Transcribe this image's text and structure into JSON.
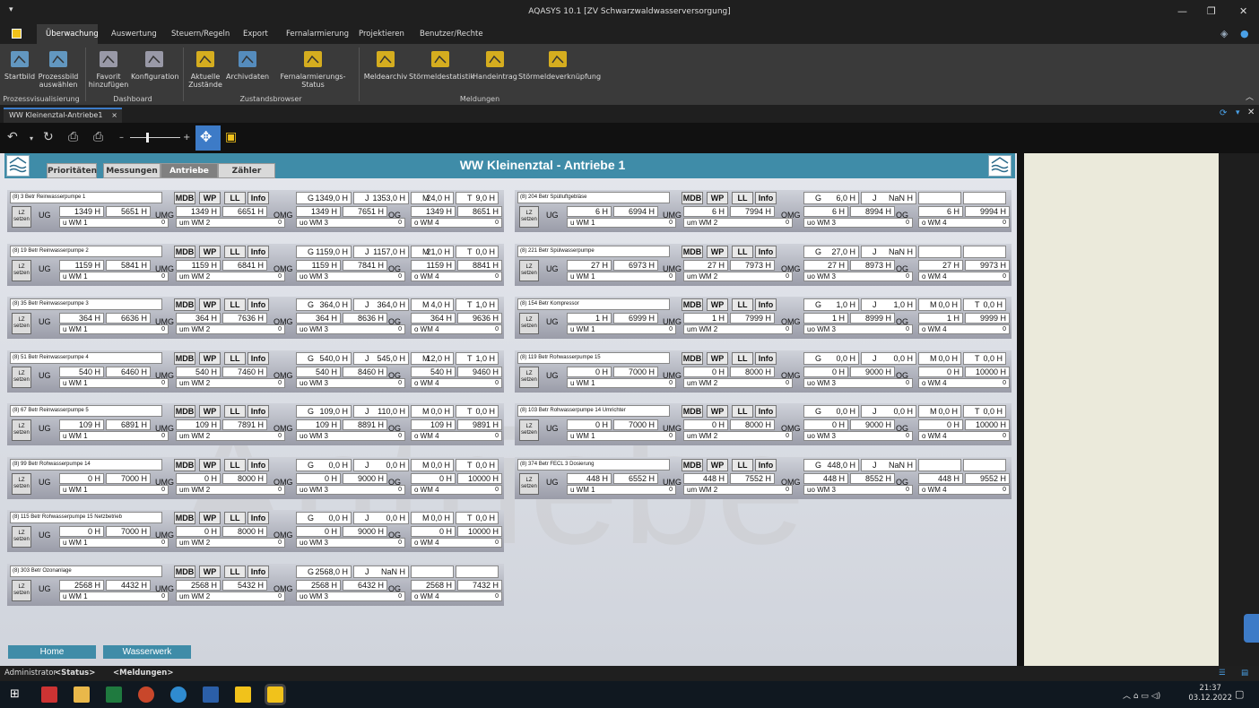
{
  "window": {
    "title": "AQASYS 10.1 [ZV Schwarzwaldwasserversorgung]",
    "qa_arrow": "▾"
  },
  "menu": [
    "Überwachung",
    "Auswertung",
    "Steuern/Regeln",
    "Export",
    "Fernalarmierung",
    "Projektieren",
    "Benutzer/Rechte"
  ],
  "ribbon": {
    "buttons": [
      {
        "label": "Startbild",
        "icon": "image-icon"
      },
      {
        "label": "Prozessbild auswählen",
        "icon": "picture-select-icon"
      },
      {
        "label": "Favorit hinzufügen",
        "icon": "favorite-eye-icon"
      },
      {
        "label": "Konfiguration",
        "icon": "config-gear-icon"
      },
      {
        "label": "Aktuelle Zustände",
        "icon": "current-states-icon"
      },
      {
        "label": "Archivdaten",
        "icon": "database-icon"
      },
      {
        "label": "Fernalarmierungs-Status",
        "icon": "alarm-status-icon"
      },
      {
        "label": "Meldearchiv",
        "icon": "message-archive-icon"
      },
      {
        "label": "Störmeldestatistik",
        "icon": "fault-statistics-icon"
      },
      {
        "label": "Handeintrag",
        "icon": "manual-entry-icon"
      },
      {
        "label": "Störmeldeverknüpfung",
        "icon": "fault-link-icon"
      }
    ],
    "groups": [
      "Prozessvisualisierung",
      "Dashboard",
      "Zustandsbrowser",
      "Meldungen"
    ]
  },
  "doctab": {
    "label": "WW Kleinenztal-Antriebe1",
    "close": "×"
  },
  "page": {
    "title": "WW Kleinenztal - Antriebe 1",
    "tabs": [
      "Prioritäten",
      "Messungen",
      "Antriebe",
      "Zähler"
    ],
    "active_tab": "Antriebe",
    "watermark": "Antriebe"
  },
  "labels": {
    "ug": "UG",
    "umg": "UMG",
    "omg": "OMG",
    "og": "OG",
    "lz": "LZ",
    "setzen": "setzen",
    "mdb": "MDB",
    "wp": "WP",
    "ll": "LL",
    "info": "Info",
    "uwm": "u WM 1",
    "umwm": "um WM 2",
    "uowm": "uo WM 3",
    "owm": "o WM 4"
  },
  "units": [
    {
      "pri": "(8)",
      "id": "3",
      "name": "Betr Reinwasserpumpe 1",
      "h": [
        [
          "G",
          "1349,0 H"
        ],
        [
          "J",
          "1353,0 H"
        ],
        [
          "M",
          "24,0 H"
        ],
        [
          "T",
          "9,0 H"
        ]
      ],
      "v": [
        "1349 H",
        "5651 H",
        "1349 H",
        "6651 H",
        "1349 H",
        "7651 H",
        "1349 H",
        "8651 H"
      ]
    },
    {
      "pri": "(8)",
      "id": "19",
      "name": "Betr Reinwasserpumpe 2",
      "h": [
        [
          "G",
          "1159,0 H"
        ],
        [
          "J",
          "1157,0 H"
        ],
        [
          "M",
          "21,0 H"
        ],
        [
          "T",
          "0,0 H"
        ]
      ],
      "v": [
        "1159 H",
        "5841 H",
        "1159 H",
        "6841 H",
        "1159 H",
        "7841 H",
        "1159 H",
        "8841 H"
      ]
    },
    {
      "pri": "(8)",
      "id": "35",
      "name": "Betr Reinwasserpumpe 3",
      "h": [
        [
          "G",
          "364,0 H"
        ],
        [
          "J",
          "364,0 H"
        ],
        [
          "M",
          "4,0 H"
        ],
        [
          "T",
          "1,0 H"
        ]
      ],
      "v": [
        "364 H",
        "6636 H",
        "364 H",
        "7636 H",
        "364 H",
        "8636 H",
        "364 H",
        "9636 H"
      ]
    },
    {
      "pri": "(8)",
      "id": "51",
      "name": "Betr Reinwasserpumpe 4",
      "h": [
        [
          "G",
          "540,0 H"
        ],
        [
          "J",
          "545,0 H"
        ],
        [
          "M",
          "12,0 H"
        ],
        [
          "T",
          "1,0 H"
        ]
      ],
      "v": [
        "540 H",
        "6460 H",
        "540 H",
        "7460 H",
        "540 H",
        "8460 H",
        "540 H",
        "9460 H"
      ]
    },
    {
      "pri": "(8)",
      "id": "67",
      "name": "Betr Reinwasserpumpe 5",
      "h": [
        [
          "G",
          "109,0 H"
        ],
        [
          "J",
          "110,0 H"
        ],
        [
          "M",
          "0,0 H"
        ],
        [
          "T",
          "0,0 H"
        ]
      ],
      "v": [
        "109 H",
        "6891 H",
        "109 H",
        "7891 H",
        "109 H",
        "8891 H",
        "109 H",
        "9891 H"
      ]
    },
    {
      "pri": "(8)",
      "id": "99",
      "name": "Betr Rohwasserpumpe 14",
      "h": [
        [
          "G",
          "0,0 H"
        ],
        [
          "J",
          "0,0 H"
        ],
        [
          "M",
          "0,0 H"
        ],
        [
          "T",
          "0,0 H"
        ]
      ],
      "v": [
        "0 H",
        "7000 H",
        "0 H",
        "8000 H",
        "0 H",
        "9000 H",
        "0 H",
        "10000 H"
      ]
    },
    {
      "pri": "(8)",
      "id": "115",
      "name": "Betr Rohwasserpumpe 15 Netzbetrieb",
      "h": [
        [
          "G",
          "0,0 H"
        ],
        [
          "J",
          "0,0 H"
        ],
        [
          "M",
          "0,0 H"
        ],
        [
          "T",
          "0,0 H"
        ]
      ],
      "v": [
        "0 H",
        "7000 H",
        "0 H",
        "8000 H",
        "0 H",
        "9000 H",
        "0 H",
        "10000 H"
      ]
    },
    {
      "pri": "(8)",
      "id": "303",
      "name": "Betr Ozonanlage",
      "h": [
        [
          "G",
          "2568,0 H"
        ],
        [
          "J",
          "NaN H"
        ],
        [
          "",
          ""
        ],
        [
          "",
          ""
        ]
      ],
      "v": [
        "2568 H",
        "4432 H",
        "2568 H",
        "5432 H",
        "2568 H",
        "6432 H",
        "2568 H",
        "7432 H"
      ]
    },
    {
      "pri": "(8)",
      "id": "204",
      "name": "Betr Spülluftgebläse",
      "h": [
        [
          "G",
          "6,0 H"
        ],
        [
          "J",
          "NaN H"
        ],
        [
          "",
          ""
        ],
        [
          "",
          ""
        ]
      ],
      "v": [
        "6 H",
        "6994 H",
        "6 H",
        "7994 H",
        "6 H",
        "8994 H",
        "6 H",
        "9994 H"
      ]
    },
    {
      "pri": "(8)",
      "id": "221",
      "name": "Betr Spülwasserpumpe",
      "h": [
        [
          "G",
          "27,0 H"
        ],
        [
          "J",
          "NaN H"
        ],
        [
          "",
          ""
        ],
        [
          "",
          ""
        ]
      ],
      "v": [
        "27 H",
        "6973 H",
        "27 H",
        "7973 H",
        "27 H",
        "8973 H",
        "27 H",
        "9973 H"
      ]
    },
    {
      "pri": "(8)",
      "id": "154",
      "name": "Betr Kompressor",
      "h": [
        [
          "G",
          "1,0 H"
        ],
        [
          "J",
          "1,0 H"
        ],
        [
          "M",
          "0,0 H"
        ],
        [
          "T",
          "0,0 H"
        ]
      ],
      "v": [
        "1 H",
        "6999 H",
        "1 H",
        "7999 H",
        "1 H",
        "8999 H",
        "1 H",
        "9999 H"
      ]
    },
    {
      "pri": "(8)",
      "id": "119",
      "name": "Betr Rohwasserpumpe 15",
      "h": [
        [
          "G",
          "0,0 H"
        ],
        [
          "J",
          "0,0 H"
        ],
        [
          "M",
          "0,0 H"
        ],
        [
          "T",
          "0,0 H"
        ]
      ],
      "v": [
        "0 H",
        "7000 H",
        "0 H",
        "8000 H",
        "0 H",
        "9000 H",
        "0 H",
        "10000 H"
      ]
    },
    {
      "pri": "(8)",
      "id": "103",
      "name": "Betr Rohwasserpumpe 14 Umrichter",
      "h": [
        [
          "G",
          "0,0 H"
        ],
        [
          "J",
          "0,0 H"
        ],
        [
          "M",
          "0,0 H"
        ],
        [
          "T",
          "0,0 H"
        ]
      ],
      "v": [
        "0 H",
        "7000 H",
        "0 H",
        "8000 H",
        "0 H",
        "9000 H",
        "0 H",
        "10000 H"
      ]
    },
    {
      "pri": "(8)",
      "id": "374",
      "name": "Betr FECL 3 Dosierung",
      "h": [
        [
          "G",
          "448,0 H"
        ],
        [
          "J",
          "NaN H"
        ],
        [
          "",
          ""
        ],
        [
          "",
          ""
        ]
      ],
      "v": [
        "448 H",
        "6552 H",
        "448 H",
        "7552 H",
        "448 H",
        "8552 H",
        "448 H",
        "9552 H"
      ]
    }
  ],
  "bottom_buttons": [
    "Home",
    "Wasserwerk"
  ],
  "status": {
    "user": "Administrator",
    "status": "<Status>",
    "messages": "<Meldungen>"
  },
  "clock": {
    "time": "21:37",
    "date": "03.12.2022"
  },
  "colors": {
    "accent": "#3f8ca8",
    "ribbon": "#3a3a3a",
    "panel": "#d0d4dc"
  }
}
